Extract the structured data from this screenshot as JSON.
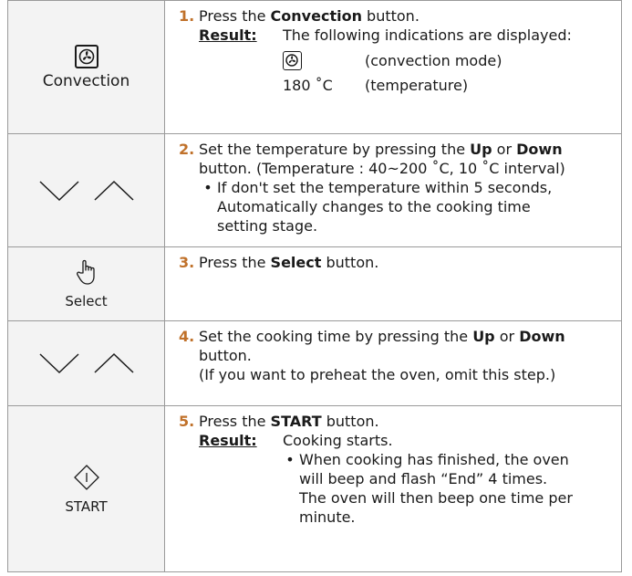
{
  "steps": [
    {
      "icon": "convection-fan-icon",
      "icon_label": "Convection",
      "number": "1.",
      "text_pre": "Press the ",
      "text_bold": "Convection",
      "text_post": " button.",
      "result_label": "Result:",
      "result_text": "The following indications are displayed:",
      "display_rows": [
        {
          "left": "",
          "left_icon": "convection-fan-icon",
          "right": "(convection mode)"
        },
        {
          "left": "180 ˚C",
          "right": "(temperature)"
        }
      ]
    },
    {
      "icon": "down-up-chevron-icons",
      "number": "2.",
      "line1_pre": "Set the temperature by pressing the ",
      "line1_b1": "Up",
      "line1_mid": " or ",
      "line1_b2": "Down",
      "line2": "button. (Temperature : 40~200 ˚C, 10 ˚C interval)",
      "bullet": "•",
      "bullet_text_1": "If don't set the temperature within 5 seconds,",
      "bullet_text_2": "Automatically changes to the cooking time",
      "bullet_text_3": "setting stage."
    },
    {
      "icon": "hand-pointer-icon",
      "icon_label": "Select",
      "number": "3.",
      "text_pre": "Press the ",
      "text_bold": "Select",
      "text_post": " button."
    },
    {
      "icon": "down-up-chevron-icons",
      "number": "4.",
      "line1_pre": "Set the cooking time by pressing the ",
      "line1_b1": "Up",
      "line1_mid": " or ",
      "line1_b2": "Down",
      "line2": "button.",
      "line3": "(If you want to preheat the oven, omit this step.)"
    },
    {
      "icon": "start-diamond-icon",
      "icon_label": "START",
      "number": "5.",
      "text_pre": "Press the ",
      "text_bold": "START",
      "text_post": " button.",
      "result_label": "Result:",
      "result_text": "Cooking starts.",
      "bullet": "•",
      "bullet_lines": [
        "When cooking has finished, the oven",
        "will beep and flash “End” 4 times.",
        "The oven will then beep one time per",
        "minute."
      ]
    }
  ]
}
